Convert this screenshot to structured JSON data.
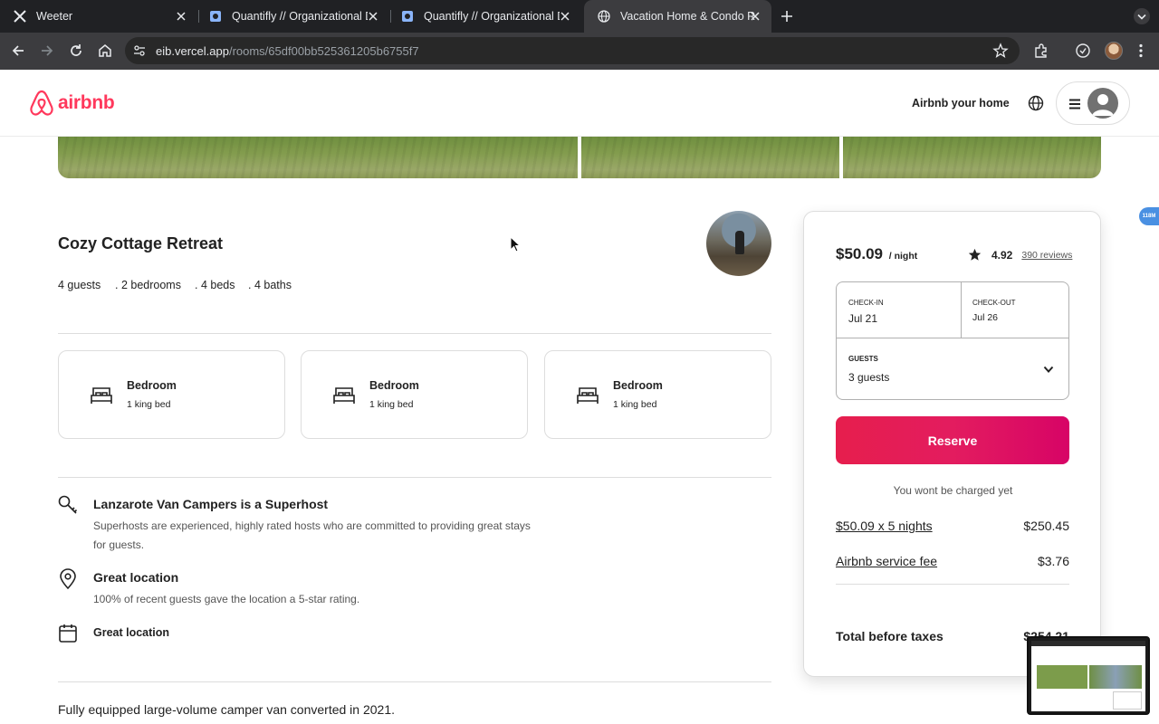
{
  "browser": {
    "tabs": [
      {
        "title": "Weeter",
        "active": false
      },
      {
        "title": "Quantifly // Organizational Dia",
        "active": false
      },
      {
        "title": "Quantifly // Organizational Dia",
        "active": false
      },
      {
        "title": "Vacation Home & Condo Rent",
        "active": true
      }
    ],
    "url_host": "eib.vercel.app",
    "url_path": "/rooms/65df00bb525361205b6755f7"
  },
  "header": {
    "logo_text": "airbnb",
    "host_link": "Airbnb your home",
    "brand_color": "#ff385c"
  },
  "listing": {
    "title": "Cozy Cottage Retreat",
    "stats": [
      "4 guests",
      ". 2 bedrooms",
      ". 4 beds",
      ". 4 baths"
    ],
    "rooms": [
      {
        "name": "Bedroom",
        "beds": "1 king bed"
      },
      {
        "name": "Bedroom",
        "beds": "1 king bed"
      },
      {
        "name": "Bedroom",
        "beds": "1 king bed"
      }
    ],
    "features": [
      {
        "icon": "key-icon",
        "title": "Lanzarote Van Campers is a Superhost",
        "desc": "Superhosts are experienced, highly rated hosts who are committed to providing great stays for guests."
      },
      {
        "icon": "location-pin-icon",
        "title": "Great location",
        "desc": "100% of recent guests gave the location a 5-star rating."
      },
      {
        "icon": "calendar-icon",
        "title": "Great location",
        "desc": ""
      }
    ],
    "description": "Fully equipped large-volume camper van converted in 2021."
  },
  "booking": {
    "price": "$50.09",
    "per_night": "/ night",
    "rating": "4.92",
    "reviews": "390 reviews",
    "checkin_label": "CHECK-IN",
    "checkin_value": "Jul 21",
    "checkout_label": "CHECK-OUT",
    "checkout_value": "Jul 26",
    "guests_label": "GUESTS",
    "guests_value": "3 guests",
    "reserve_label": "Reserve",
    "no_charge": "You wont be charged yet",
    "nights_label": "$50.09 x 5 nights",
    "nights_value": "$250.45",
    "fee_label": "Airbnb service fee",
    "fee_value": "$3.76",
    "total_label": "Total before taxes",
    "total_value": "$254.21"
  },
  "overlay": {
    "extension_badge": "118M"
  }
}
